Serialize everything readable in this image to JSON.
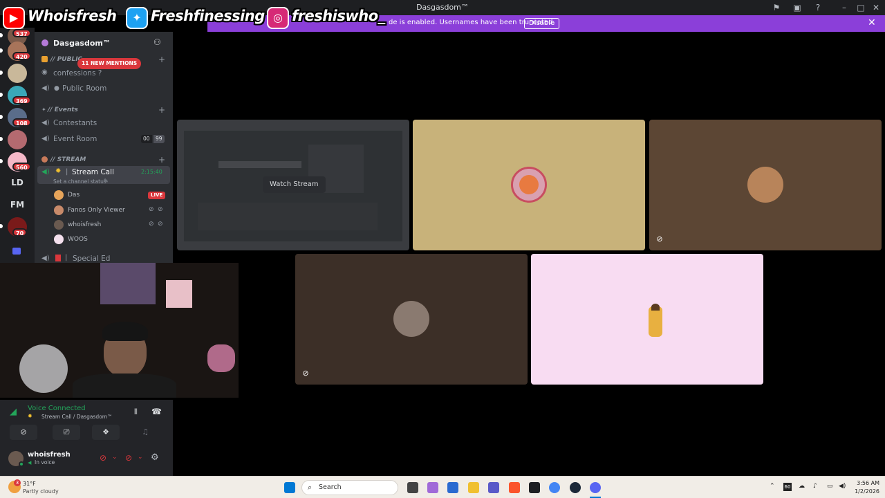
{
  "window": {
    "title": "Dasgasdom™"
  },
  "social_overlay": {
    "youtube": "Whoisfresh",
    "twitter": "Freshfinessing",
    "instagram": "freshiswho_"
  },
  "notice": {
    "text": "de is enabled. Usernames have been truncated.",
    "button": "Disable"
  },
  "rail": {
    "badges": [
      "537",
      "420",
      "369",
      "108",
      "560",
      "70"
    ],
    "text_servers": [
      "LD",
      "FM"
    ]
  },
  "sidebar": {
    "server_name": "Dasgasdom™",
    "mentions_pill": "11 NEW MENTIONS",
    "categories": {
      "public": "// PUBLIC",
      "events": "// Events",
      "stream": "// STREAM"
    },
    "channels": {
      "confessions": "confessions ?",
      "public_room": "Public Room",
      "contestants": "Contestants",
      "event_room": "Event Room",
      "event_room_count_a": "00",
      "event_room_count_b": "99",
      "stream_call": "Stream Call",
      "stream_call_timer": "2:15:40",
      "channel_status": "Set a channel status",
      "special_ed": "Special Ed"
    },
    "members": [
      {
        "name": "Das",
        "live": "LIVE"
      },
      {
        "name": "Fanos Only Viewer"
      },
      {
        "name": "whoisfresh"
      },
      {
        "name": "WOOS"
      }
    ]
  },
  "stage": {
    "watch_stream": "Watch Stream"
  },
  "voice_panel": {
    "status": "Voice Connected",
    "location": "Stream Call / Dasgasdom™",
    "username": "whoisfresh",
    "user_status": "In voice"
  },
  "taskbar": {
    "weather_temp": "31°F",
    "weather_desc": "Partly cloudy",
    "weather_badge": "3",
    "search": "Search",
    "time": "3:56 AM",
    "date": "1/2/2026",
    "tray_box": "60"
  },
  "colors": {
    "discord_bg": "#2b2d31",
    "rail_bg": "#1e1f22",
    "notice": "#8b3fd9",
    "green": "#23a55a",
    "red": "#da373c",
    "tile_gold": "#c8b27a",
    "tile_brown": "#5c4634",
    "tile_dark_brown": "#3c2f27",
    "tile_pink": "#f8dcf2"
  }
}
